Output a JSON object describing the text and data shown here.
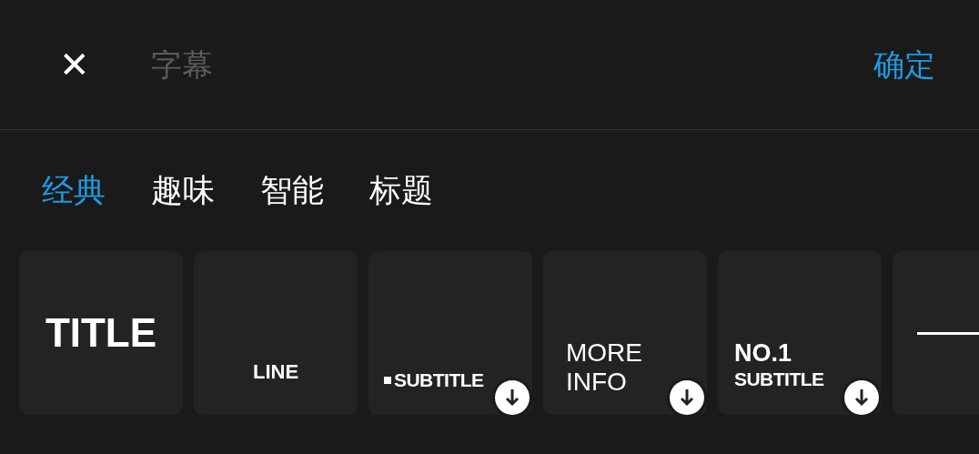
{
  "header": {
    "close_icon": "✕",
    "title": "字幕",
    "confirm": "确定"
  },
  "tabs": [
    {
      "label": "经典",
      "selected": true
    },
    {
      "label": "趣味",
      "selected": false
    },
    {
      "label": "智能",
      "selected": false
    },
    {
      "label": "标题",
      "selected": false
    }
  ],
  "cards": [
    {
      "kind": "title",
      "lines": [
        "TITLE"
      ],
      "download": false
    },
    {
      "kind": "line",
      "lines": [
        "LINE"
      ],
      "download": false
    },
    {
      "kind": "bullet",
      "lines": [
        "SUBTITLE"
      ],
      "download": true
    },
    {
      "kind": "info",
      "lines": [
        "MORE",
        "INFO"
      ],
      "download": true
    },
    {
      "kind": "numbered",
      "lines": [
        "NO.1",
        "SUBTITLE"
      ],
      "download": true
    },
    {
      "kind": "rule",
      "download": false
    }
  ]
}
